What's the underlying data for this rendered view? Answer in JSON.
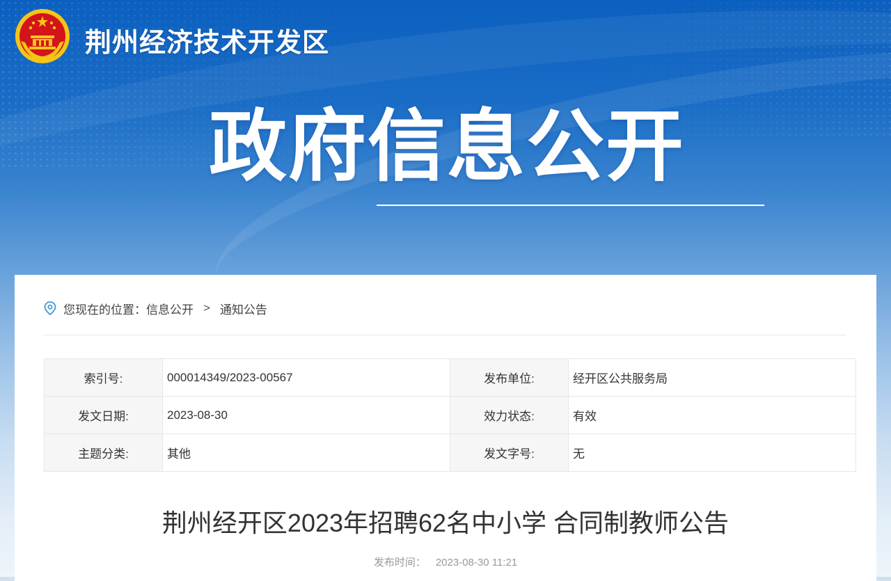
{
  "header": {
    "site_title": "荆州经济技术开发区",
    "banner_title": "政府信息公开"
  },
  "breadcrumb": {
    "prefix": "您现在的位置：",
    "items": [
      "信息公开",
      "通知公告"
    ],
    "separator": ">"
  },
  "meta": {
    "rows": [
      {
        "label1": "索引号:",
        "value1": "000014349/2023-00567",
        "label2": "发布单位:",
        "value2": "经开区公共服务局"
      },
      {
        "label1": "发文日期:",
        "value1": "2023-08-30",
        "label2": "效力状态:",
        "value2": "有效"
      },
      {
        "label1": "主题分类:",
        "value1": "其他",
        "label2": "发文字号:",
        "value2": "无"
      }
    ]
  },
  "article": {
    "title": "荆州经开区2023年招聘62名中小学 合同制教师公告",
    "publish_label": "发布时间：",
    "publish_time": "2023-08-30 11:21"
  },
  "colors": {
    "banner_top": "#0b5fbf",
    "emblem_red": "#d3141b",
    "emblem_gold": "#f5c518",
    "location_icon": "#3a9bd8"
  }
}
